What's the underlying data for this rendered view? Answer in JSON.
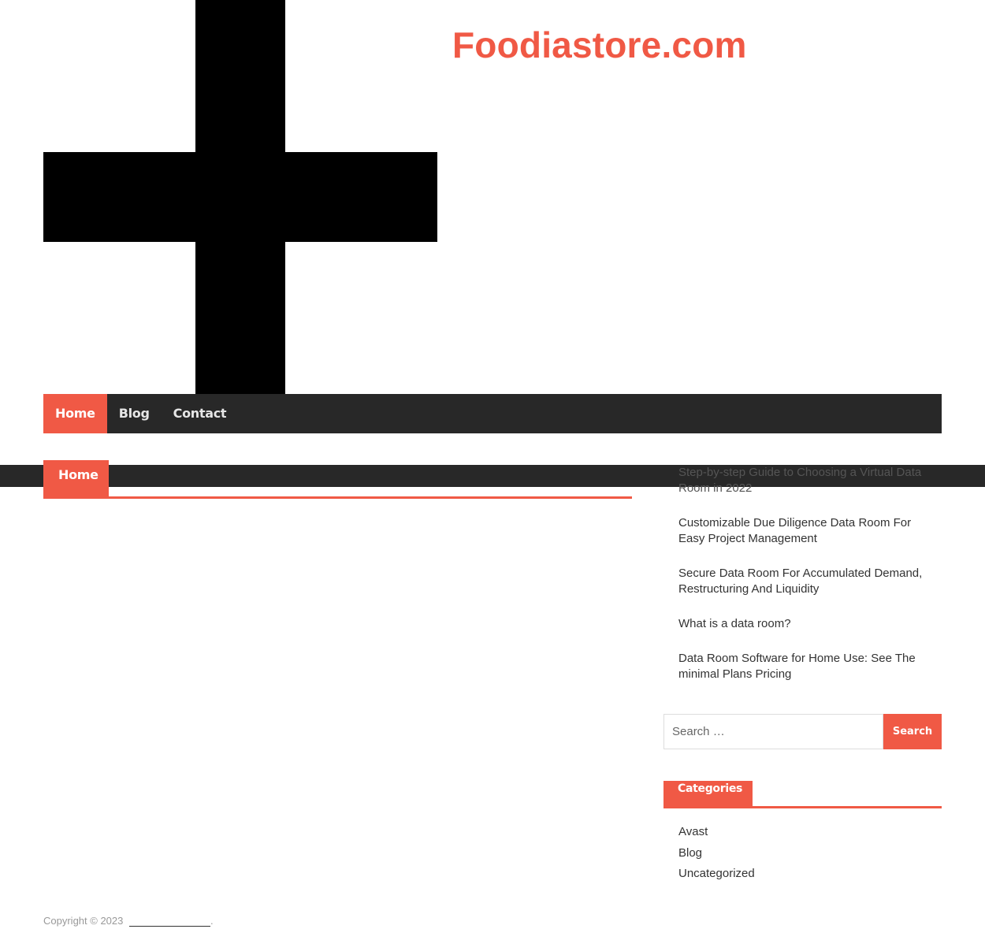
{
  "site": {
    "title": "Foodiastore.com"
  },
  "nav": {
    "items": [
      {
        "label": "Home",
        "active": true
      },
      {
        "label": "Blog",
        "active": false
      },
      {
        "label": "Contact",
        "active": false
      }
    ]
  },
  "main": {
    "section_title": "Home"
  },
  "sidebar": {
    "recent_posts": [
      "Step-by-step Guide to Choosing a Virtual Data Room in 2022",
      "Customizable Due Diligence Data Room For Easy Project Management",
      "Secure Data Room For Accumulated Demand, Restructuring And Liquidity",
      "What is a data room?",
      "Data Room Software for Home Use: See The minimal Plans Pricing"
    ],
    "search": {
      "placeholder": "Search …",
      "button_label": "Search"
    },
    "categories_title": "Categories",
    "categories": [
      "Avast",
      "Blog",
      "Uncategorized"
    ]
  },
  "footer": {
    "copyright": "Copyright © 2023",
    "trailing": "."
  },
  "colors": {
    "accent": "#f05945",
    "nav_background": "#282828",
    "logo_cross": "#000000"
  },
  "icons": {
    "logo": "cross-icon"
  }
}
